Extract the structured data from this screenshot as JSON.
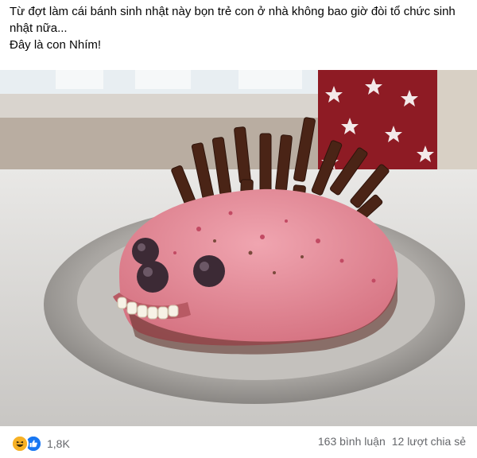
{
  "post": {
    "text_line1": "Từ đợt làm cái bánh sinh nhật này bọn trẻ con ở nhà không bao giờ đòi tổ chức sinh nhật nữa...",
    "text_line2": "Đây là con Nhím!"
  },
  "photo": {
    "icon": "photo-image",
    "subject": "hedgehog-shaped pink birthday cake on a metal tray"
  },
  "reactions": {
    "icons": [
      "haha-icon",
      "like-icon"
    ],
    "count": "1,8K"
  },
  "stats": {
    "comments": "163 bình luận",
    "shares": "12 lượt chia sẻ"
  },
  "colors": {
    "like_blue": "#1877f2",
    "haha_yellow": "#f7b125",
    "secondary_text": "#65676b",
    "cake_pink": "#e58a9a",
    "curtain_red": "#8e1b24"
  }
}
